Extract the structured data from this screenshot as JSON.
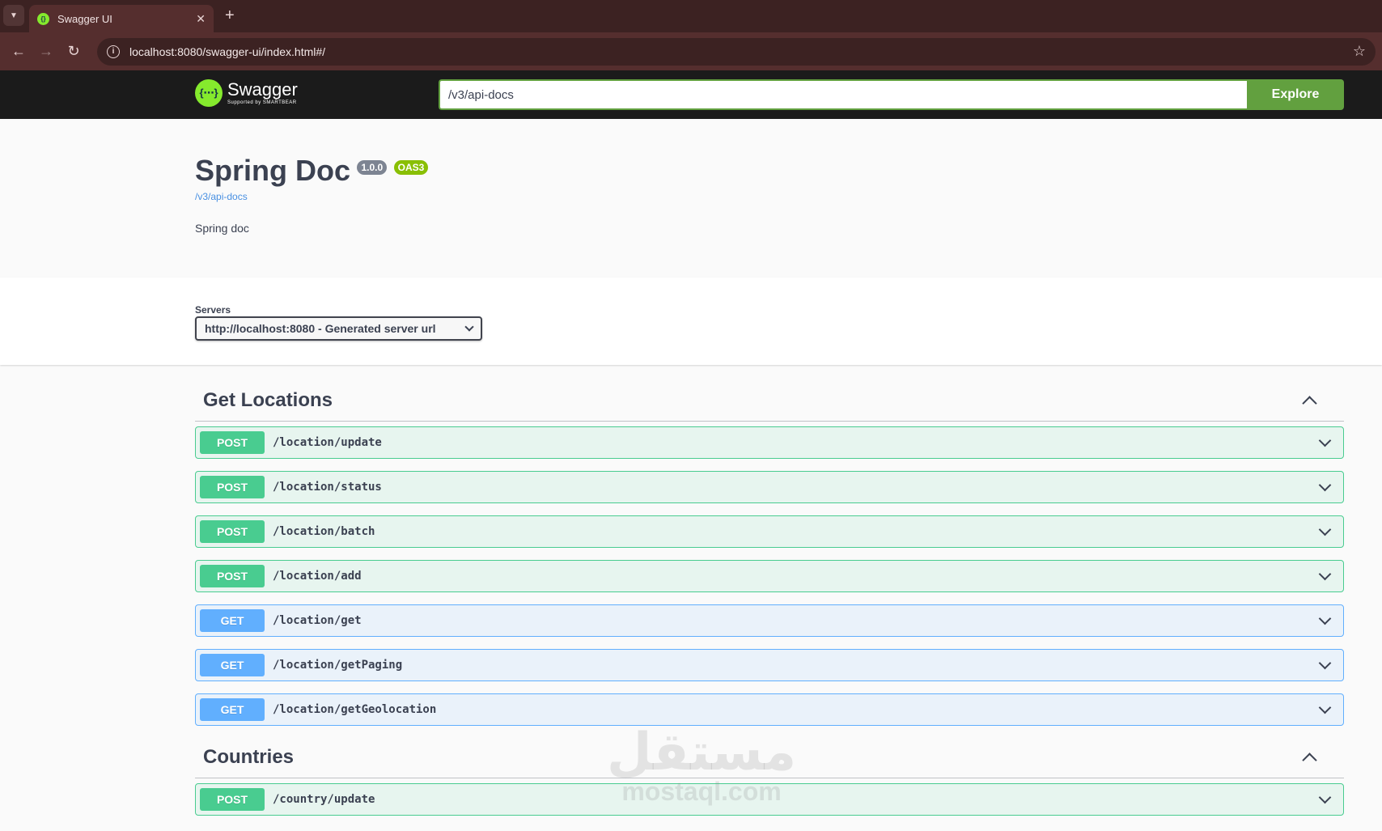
{
  "browser": {
    "tab_title": "Swagger UI",
    "url": "localhost:8080/swagger-ui/index.html#/"
  },
  "topbar": {
    "logo_title": "Swagger",
    "logo_sub": "Supported by SMARTBEAR",
    "spec_url": "/v3/api-docs",
    "explore_label": "Explore"
  },
  "info": {
    "title": "Spring Doc",
    "version": "1.0.0",
    "oas": "OAS3",
    "link": "/v3/api-docs",
    "description": "Spring doc"
  },
  "servers": {
    "label": "Servers",
    "selected": "http://localhost:8080 - Generated server url"
  },
  "tags": [
    {
      "name": "Get Locations",
      "operations": [
        {
          "method": "POST",
          "path": "/location/update"
        },
        {
          "method": "POST",
          "path": "/location/status"
        },
        {
          "method": "POST",
          "path": "/location/batch"
        },
        {
          "method": "POST",
          "path": "/location/add"
        },
        {
          "method": "GET",
          "path": "/location/get"
        },
        {
          "method": "GET",
          "path": "/location/getPaging"
        },
        {
          "method": "GET",
          "path": "/location/getGeolocation"
        }
      ]
    },
    {
      "name": "Countries",
      "operations": [
        {
          "method": "POST",
          "path": "/country/update"
        }
      ]
    }
  ],
  "watermark": {
    "arabic": "مستقل",
    "latin": "mostaql.com"
  },
  "colors": {
    "post": "#49cc90",
    "get": "#61affe",
    "swagger_green": "#85ea2d",
    "explore": "#62a03f"
  }
}
